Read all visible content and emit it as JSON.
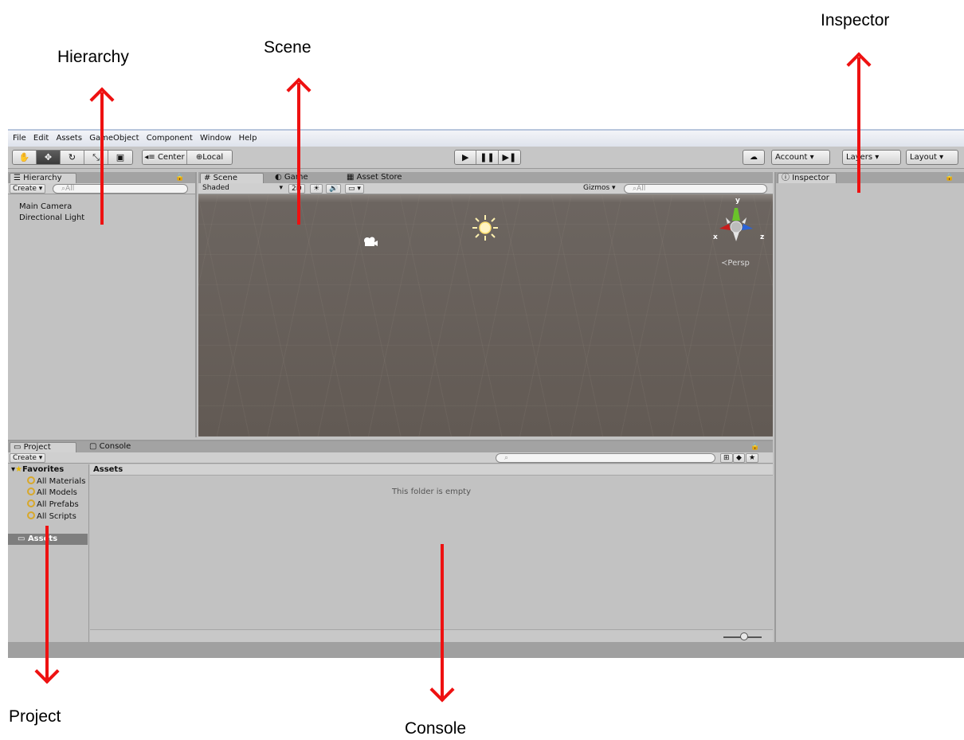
{
  "callouts": {
    "hierarchy": "Hierarchy",
    "scene": "Scene",
    "inspector": "Inspector",
    "project": "Project",
    "console": "Console"
  },
  "menu": [
    "File",
    "Edit",
    "Assets",
    "GameObject",
    "Component",
    "Window",
    "Help"
  ],
  "toolbar": {
    "tools": [
      "hand-icon",
      "move-icon",
      "rotate-icon",
      "scale-icon",
      "rect-icon"
    ],
    "pivot": "Center",
    "space": "Local",
    "play_icons": [
      "play-icon",
      "pause-icon",
      "step-icon"
    ],
    "account": "Account",
    "layers": "Layers",
    "layout": "Layout"
  },
  "hierarchy": {
    "tab": "Hierarchy",
    "create": "Create",
    "search_placeholder": "All",
    "items": [
      "Main Camera",
      "Directional Light"
    ]
  },
  "scene": {
    "tabs": [
      "Scene",
      "Game",
      "Asset Store"
    ],
    "shading": "Shaded",
    "mode_2d": "2D",
    "gizmos": "Gizmos",
    "search_placeholder": "All",
    "persp": "Persp",
    "axes": {
      "x": "x",
      "y": "y",
      "z": "z"
    }
  },
  "inspector": {
    "tab": "Inspector"
  },
  "project": {
    "tabs": [
      "Project",
      "Console"
    ],
    "create": "Create",
    "favorites": "Favorites",
    "favorite_items": [
      "All Materials",
      "All Models",
      "All Prefabs",
      "All Scripts"
    ],
    "assets_root": "Assets",
    "assets_header": "Assets",
    "empty_message": "This folder is empty"
  },
  "colors": {
    "arrow": "#ee1111",
    "panel_bg": "#c2c2c2",
    "scene_bg": "#625a54"
  }
}
